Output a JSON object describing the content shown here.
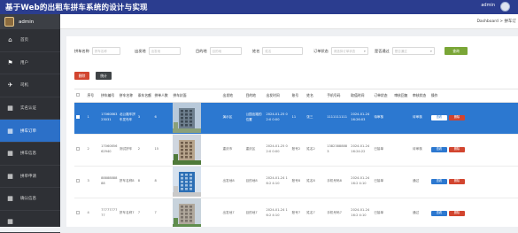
{
  "app": {
    "title": "基于Web的出租车拼车系统的设计与实现",
    "admin_label": "admin"
  },
  "sidebar": {
    "user": "admin",
    "items": [
      {
        "label": "首页",
        "icon": "home-icon",
        "glyph": "⌂",
        "active": false
      },
      {
        "label": "用户",
        "icon": "flag-icon",
        "glyph": "⚑",
        "active": false
      },
      {
        "label": "司机",
        "icon": "send-icon",
        "glyph": "✈",
        "active": false
      },
      {
        "label": "实名认证",
        "icon": "grid-icon",
        "glyph": "▦",
        "active": false
      },
      {
        "label": "拼车订单",
        "icon": "grid-icon",
        "glyph": "▦",
        "active": true
      },
      {
        "label": "拼车信息",
        "icon": "grid-icon",
        "glyph": "▦",
        "active": false
      },
      {
        "label": "拼单申请",
        "icon": "grid-icon",
        "glyph": "▦",
        "active": false
      },
      {
        "label": "确认信息",
        "icon": "grid-icon",
        "glyph": "▦",
        "active": false
      },
      {
        "label": "",
        "icon": "grid-icon",
        "glyph": "▦",
        "active": false
      }
    ]
  },
  "breadcrumb": "Dashboard > 拼车订",
  "search": {
    "order_no_label": "拼车名称",
    "order_no_ph": "拼车名称",
    "origin_label": "出发地",
    "origin_ph": "出发地",
    "dest_label": "目的地",
    "dest_ph": "目的地",
    "name_label": "姓名",
    "name_ph": "姓名",
    "status_label": "订单状态",
    "status_ph": "请选择订单状态",
    "pass_label": "是否通过",
    "pass_ph": "是否通过",
    "button": "查询"
  },
  "actions": {
    "delete": "删除",
    "stats": "统计",
    "view": "查看",
    "row_delete": "删除"
  },
  "table": {
    "headers": [
      "",
      "序号",
      "拼车编号",
      "拼车名称",
      "乘车名额",
      "拼单人数",
      "拼车封面",
      "出发地",
      "目的地",
      "出发时间",
      "账号",
      "姓名",
      "手机号码",
      "取值时间",
      "订单状态",
      "审核回复",
      "审核状态",
      "操作"
    ],
    "rows": [
      {
        "idx": "1",
        "no": "1706086323031",
        "name": "北公路车拼车发布车",
        "seats": "3",
        "people": "6",
        "img": "photo-building-1",
        "from": "演示区",
        "to": "公园出路的位置",
        "time": "2024-01-25 02:0 0:00",
        "acct": "11",
        "uname": "张三",
        "phone": "1111111111",
        "pick": "2024-01-24 16:26:03",
        "status": "待审核",
        "reply": "",
        "review": "待审核",
        "selected": true
      },
      {
        "idx": "2",
        "no": "1706085662940",
        "name": "测试拼车",
        "seats": "2",
        "people": "15",
        "img": "photo-building-2",
        "from": "重庆市",
        "to": "重庆区",
        "time": "2024-01-25 02:0 0:00",
        "acct": "账号2",
        "uname": "姓名2",
        "phone": "13823888883",
        "pick": "2024-01-24 16:24:22",
        "status": "已接单",
        "reply": "",
        "review": "待审核",
        "selected": false
      },
      {
        "idx": "3",
        "no": "8888888888",
        "name": "拼车名称8",
        "seats": "8",
        "people": "8",
        "img": "photo-building-3",
        "from": "出发地8",
        "to": "目的地8",
        "time": "2024-01-24 16:2 4:10",
        "acct": "账号8",
        "uname": "姓名8",
        "phone": "手机号码8",
        "pick": "2024-01-24 16:2 4:10",
        "status": "已接单",
        "reply": "",
        "review": "通过",
        "selected": false
      },
      {
        "idx": "4",
        "no": "7777777777",
        "name": "拼车名称7",
        "seats": "7",
        "people": "7",
        "img": "photo-building-4",
        "from": "出发地7",
        "to": "目的地7",
        "time": "2024-01-24 16:2 4:10",
        "acct": "账号7",
        "uname": "姓名7",
        "phone": "手机号码7",
        "pick": "2024-01-24 16:2 4:10",
        "status": "已接单",
        "reply": "",
        "review": "通过",
        "selected": false
      }
    ]
  }
}
